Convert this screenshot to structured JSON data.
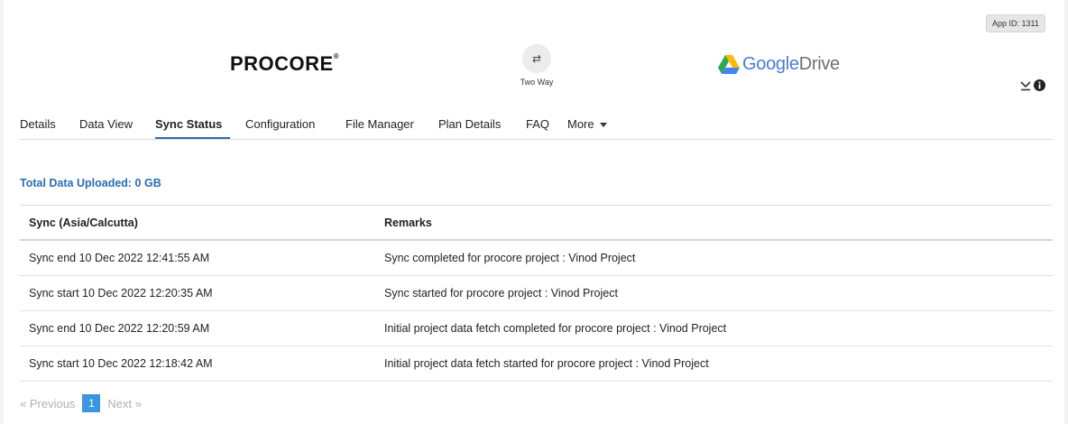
{
  "header": {
    "app_id": "App ID: 1311",
    "source_logo": "PROCORE",
    "source_logo_mark": "®",
    "sync_mode": "Two Way",
    "sync_icon": "arrows-exchange-icon",
    "target_logo_google": "Google",
    "target_logo_drive": "Drive",
    "accent_blue": "#2a6db5"
  },
  "tabs": [
    {
      "label": "Details"
    },
    {
      "label": "Data View"
    },
    {
      "label": "Sync Status",
      "active": true
    },
    {
      "label": "Configuration"
    },
    {
      "label": "File Manager"
    },
    {
      "label": "Plan Details"
    },
    {
      "label": "FAQ"
    },
    {
      "label": "More"
    }
  ],
  "summary": {
    "total_uploaded": "Total Data Uploaded: 0 GB"
  },
  "table": {
    "headers": [
      "Sync (Asia/Calcutta)",
      "Remarks"
    ],
    "rows": [
      [
        "Sync end 10 Dec 2022 12:41:55 AM",
        "Sync completed for procore project : Vinod Project"
      ],
      [
        "Sync start 10 Dec 2022 12:20:35 AM",
        "Sync started for procore project : Vinod Project"
      ],
      [
        "Sync end 10 Dec 2022 12:20:59 AM",
        "Initial project data fetch completed for procore project : Vinod Project"
      ],
      [
        "Sync start 10 Dec 2022 12:18:42 AM",
        "Initial project data fetch started for procore project : Vinod Project"
      ]
    ]
  },
  "pagination": {
    "previous": "« Previous",
    "current": "1",
    "next": "Next »"
  }
}
